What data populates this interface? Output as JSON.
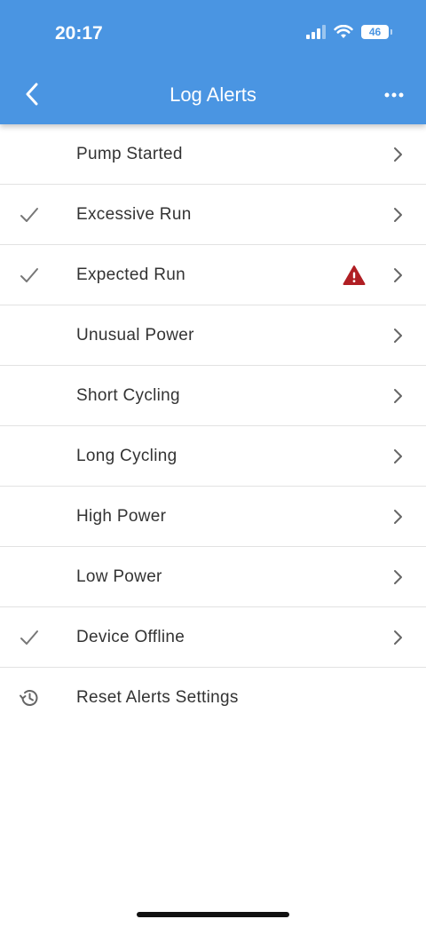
{
  "status_bar": {
    "time": "20:17",
    "battery": "46"
  },
  "header": {
    "title": "Log Alerts",
    "back_icon": "chevron-left-icon",
    "more_icon": "ellipsis-icon"
  },
  "colors": {
    "header": "#4a95e2",
    "warning": "#b01e23",
    "text": "#333333"
  },
  "alerts": [
    {
      "label": "Pump Started",
      "checked": false,
      "warning": false
    },
    {
      "label": "Excessive Run",
      "checked": true,
      "warning": false
    },
    {
      "label": "Expected Run",
      "checked": true,
      "warning": true
    },
    {
      "label": "Unusual Power",
      "checked": false,
      "warning": false
    },
    {
      "label": "Short Cycling",
      "checked": false,
      "warning": false
    },
    {
      "label": "Long Cycling",
      "checked": false,
      "warning": false
    },
    {
      "label": "High Power",
      "checked": false,
      "warning": false
    },
    {
      "label": "Low Power",
      "checked": false,
      "warning": false
    },
    {
      "label": "Device Offline",
      "checked": true,
      "warning": false
    }
  ],
  "reset": {
    "label": "Reset Alerts Settings",
    "icon": "history-icon"
  }
}
